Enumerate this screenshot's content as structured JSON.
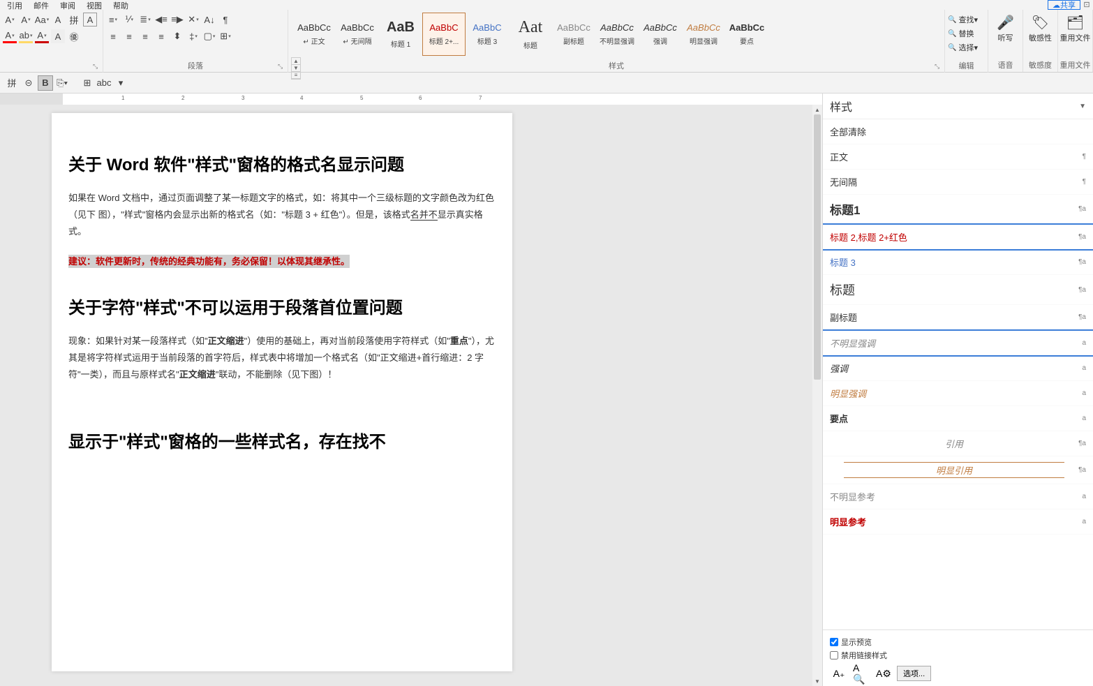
{
  "menubar": [
    "引用",
    "邮件",
    "审阅",
    "视图",
    "帮助"
  ],
  "share": "共享",
  "ribbon": {
    "font_label": "",
    "para_label": "段落",
    "styles_label": "样式",
    "edit_label": "编辑",
    "voice_label": "语音",
    "sens_label": "敏感度",
    "reuse_label": "重用文件"
  },
  "edit": {
    "find": "查找",
    "replace": "替换",
    "select": "选择"
  },
  "large_btns": {
    "voice": "听写",
    "sens": "敏感性",
    "reuse": "重用文件"
  },
  "gallery": [
    {
      "prev": "AaBbCc",
      "name": "↵ 正文",
      "cls": ""
    },
    {
      "prev": "AaBbCc",
      "name": "↵ 无间隔",
      "cls": ""
    },
    {
      "prev": "AaB",
      "name": "标题 1",
      "cls": "big"
    },
    {
      "prev": "AaBbC",
      "name": "标题 2+...",
      "cls": "red"
    },
    {
      "prev": "AaBbC",
      "name": "标题 3",
      "cls": "blue"
    },
    {
      "prev": "Aat",
      "name": "标题",
      "cls": "vbig"
    },
    {
      "prev": "AaBbCc",
      "name": "副标题",
      "cls": "gray"
    },
    {
      "prev": "AaBbCc",
      "name": "不明显强调",
      "cls": "ital"
    },
    {
      "prev": "AaBbCc",
      "name": "强调",
      "cls": "ital"
    },
    {
      "prev": "AaBbCc",
      "name": "明显强调",
      "cls": "orange"
    },
    {
      "prev": "AaBbCc",
      "name": "要点",
      "cls": "bold"
    }
  ],
  "document": {
    "h1": "关于 Word 软件\"样式\"窗格的格式名显示问题",
    "p1_a": "如果在 Word 文档中，通过页面调整了某一标题文字的格式，如：将其中一个三级标题的文字颜色改为红色（见下 图），\"样式\"窗格内会显示出新的格式名（如：\"标题 3 + 红色\"）。但是，该格式",
    "p1_u": "名并不",
    "p1_b": "显示真实格式。",
    "highlight": "建议：软件更新时，传统的经典功能有，务必保留！以体现其继承性。",
    "h2": "关于字符\"样式\"不可以运用于段落首位置问题",
    "p2_a": "现象：如果针对某一段落样式（如\"",
    "p2_b1": "正文缩进",
    "p2_b": "\"）使用的基础上，再对当前段落使用字符样式（如\"",
    "p2_b2": "重点",
    "p2_c": "\"），尤其是将字符样式运用于当前段落的首字符后，样式表中将增加一个格式名（如\"正文缩进+首行缩进：2 字符\"一类），而且与原样式名\"",
    "p2_b3": "正文缩进",
    "p2_d": "\"联动，不能删除（见下图）！",
    "h3": "显示于\"样式\"窗格的一些样式名，存在找不"
  },
  "pane": {
    "title": "样式",
    "clear": "全部清除",
    "list": [
      {
        "name": "正文",
        "mark": "¶",
        "cls": ""
      },
      {
        "name": "无间隔",
        "mark": "¶",
        "cls": ""
      },
      {
        "name": "标题1",
        "mark": "¶a",
        "cls": "h1"
      },
      {
        "name": "标题 2,标题 2+红色",
        "mark": "¶a",
        "cls": "h2-red sel"
      },
      {
        "name": "标题 3",
        "mark": "¶a",
        "cls": "h3"
      },
      {
        "name": "标题",
        "mark": "¶a",
        "cls": "title"
      },
      {
        "name": "副标题",
        "mark": "¶a",
        "cls": ""
      },
      {
        "name": "不明显强调",
        "mark": "a",
        "cls": "subtle sel"
      },
      {
        "name": "强调",
        "mark": "a",
        "cls": "emph"
      },
      {
        "name": "明显强调",
        "mark": "a",
        "cls": "intense"
      },
      {
        "name": "要点",
        "mark": "a",
        "cls": "bold-s"
      },
      {
        "name": "引用",
        "mark": "¶a",
        "cls": "quote"
      },
      {
        "name": "明显引用",
        "mark": "¶a",
        "cls": "iquote"
      },
      {
        "name": "不明显参考",
        "mark": "a",
        "cls": "subtle-ref"
      },
      {
        "name": "明显参考",
        "mark": "a",
        "cls": "ired"
      }
    ],
    "show_preview": "显示预览",
    "disable_linked": "禁用链接样式",
    "options": "选项..."
  }
}
